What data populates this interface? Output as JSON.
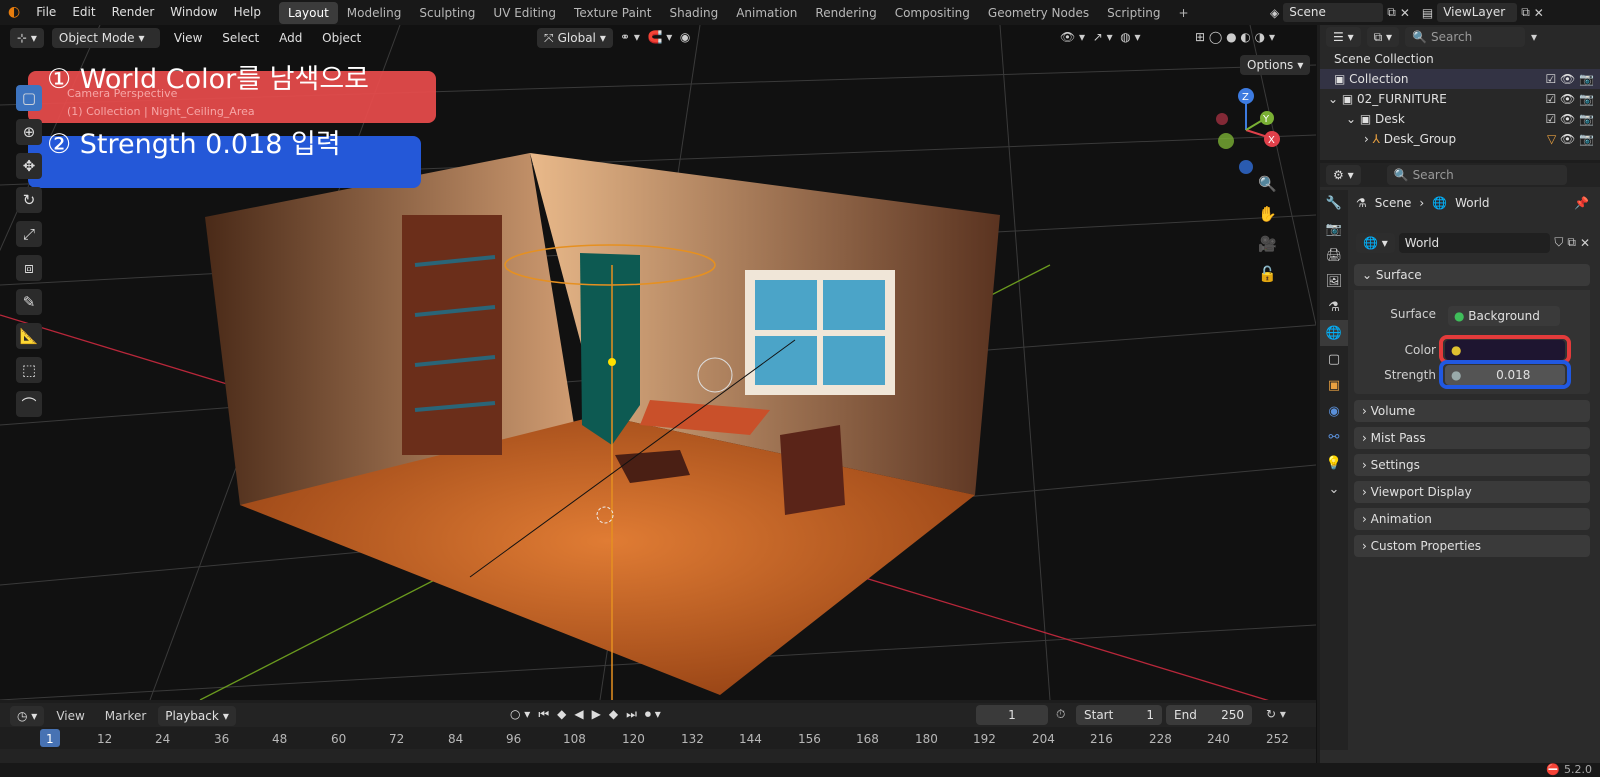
{
  "menubar": {
    "file": "File",
    "edit": "Edit",
    "render": "Render",
    "window": "Window",
    "help": "Help"
  },
  "workspaces": [
    "Layout",
    "Modeling",
    "Sculpting",
    "UV Editing",
    "Texture Paint",
    "Shading",
    "Animation",
    "Rendering",
    "Compositing",
    "Geometry Nodes",
    "Scripting"
  ],
  "scene": {
    "scene_name": "Scene",
    "view_layer": "ViewLayer"
  },
  "viewport_header": {
    "mode": "Object Mode",
    "view": "View",
    "select": "Select",
    "add": "Add",
    "object": "Object",
    "orientation": "Global",
    "options": "Options"
  },
  "viewport_overlay": {
    "camera_text": "Camera Perspective",
    "collection_text": "(1) Collection | Night_Ceiling_Area"
  },
  "annotations": {
    "step1": "① World Color를 남색으로",
    "step2": "② Strength 0.018 입력"
  },
  "outliner": {
    "search_placeholder": "Search",
    "rows": [
      {
        "label": "Scene Collection"
      },
      {
        "label": "Collection"
      },
      {
        "label": "02_FURNITURE"
      },
      {
        "label": "Desk"
      },
      {
        "label": "Desk_Group"
      }
    ]
  },
  "properties": {
    "search_placeholder": "Search",
    "breadcrumb_scene": "Scene",
    "breadcrumb_world": "World",
    "world_name": "World",
    "surface_panel": "Surface",
    "surface_label": "Surface",
    "surface_value": "Background",
    "color_label": "Color",
    "strength_label": "Strength",
    "strength_value": "0.018",
    "panels": [
      "Volume",
      "Mist Pass",
      "Settings",
      "Viewport Display",
      "Animation",
      "Custom Properties"
    ],
    "colors": {
      "world_color": "#1e1530",
      "highlight_red": "#e33b3b",
      "highlight_blue": "#2158e0"
    }
  },
  "timeline": {
    "view": "View",
    "marker": "Marker",
    "playback": "Playback",
    "current_frame": "1",
    "start_label": "Start",
    "start_value": "1",
    "end_label": "End",
    "end_value": "250",
    "frame_ticks": [
      "1",
      "12",
      "24",
      "36",
      "48",
      "60",
      "72",
      "84",
      "96",
      "108",
      "120",
      "132",
      "144",
      "156",
      "168",
      "180",
      "192",
      "204",
      "216",
      "228",
      "240",
      "252"
    ]
  },
  "status": {
    "version": "5.2.0"
  }
}
